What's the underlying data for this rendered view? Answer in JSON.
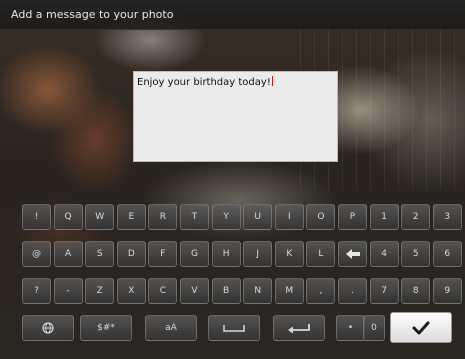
{
  "header": {
    "title": "Add a message to your photo"
  },
  "message": {
    "text": "Enjoy your birthday today!"
  },
  "keyboard": {
    "rows": [
      [
        "!",
        "Q",
        "W",
        "E",
        "R",
        "T",
        "Y",
        "U",
        "I",
        "O",
        "P",
        "1",
        "2",
        "3"
      ],
      [
        "@",
        "A",
        "S",
        "D",
        "F",
        "G",
        "H",
        "J",
        "K",
        "L",
        "",
        "4",
        "5",
        "6"
      ],
      [
        "?",
        "-",
        "Z",
        "X",
        "C",
        "V",
        "B",
        "N",
        "M",
        ",",
        ".",
        "7",
        "8",
        "9"
      ]
    ],
    "symbols_label": "$#*",
    "case_label": "aA",
    "period_label": "•",
    "zero_label": "0"
  },
  "icons": {
    "backspace": "backspace-icon",
    "globe": "globe-icon",
    "space": "space-icon",
    "enter": "enter-icon",
    "confirm": "checkmark-icon"
  },
  "colors": {
    "cursor": "#d01818",
    "message_box": "#ebebeb",
    "key": "#5a5a5a",
    "confirm_key": "#f2f2f2"
  }
}
